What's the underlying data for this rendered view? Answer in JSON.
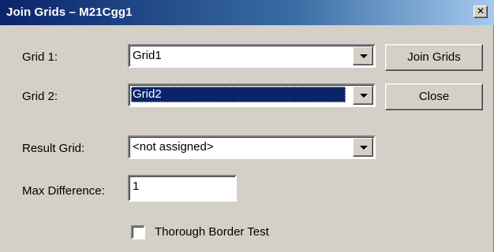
{
  "window": {
    "title": "Join Grids – M21Cgg1",
    "close_glyph": "✕"
  },
  "form": {
    "grid1": {
      "label": "Grid 1:",
      "value": "Grid1"
    },
    "grid2": {
      "label": "Grid 2:",
      "value": "Grid2",
      "selected": true
    },
    "result_grid": {
      "label": "Result Grid:",
      "value": "<not assigned>"
    },
    "max_difference": {
      "label": "Max Difference:",
      "value": "1"
    },
    "thorough_border_test": {
      "label": "Thorough Border Test",
      "checked": false
    }
  },
  "buttons": {
    "join": "Join Grids",
    "close": "Close"
  },
  "colors": {
    "titlebar_start": "#0a246a",
    "titlebar_end": "#a6caf0",
    "selection": "#0a246a",
    "face": "#d4d0c8"
  }
}
